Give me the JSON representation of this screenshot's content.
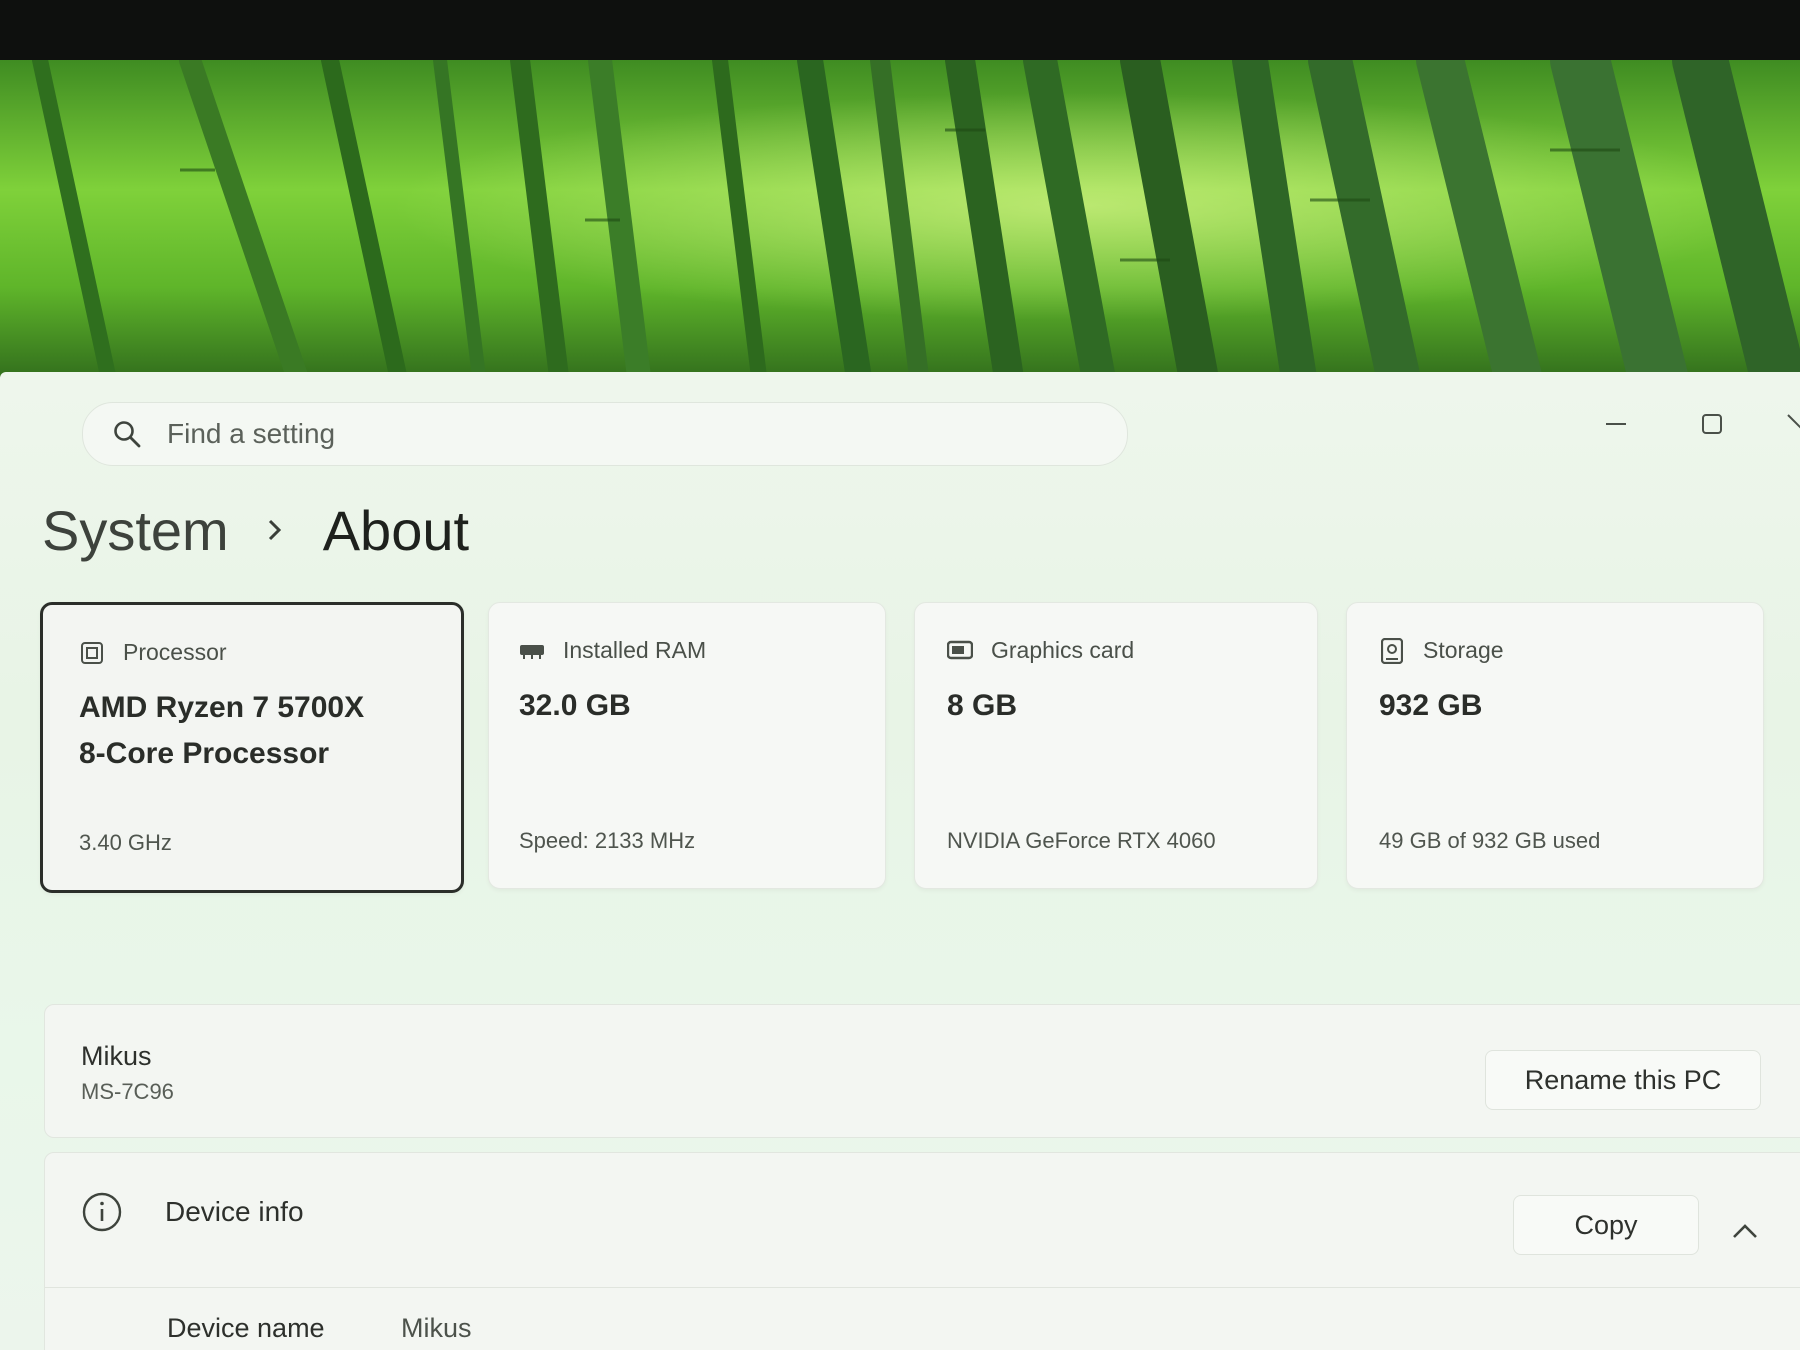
{
  "search": {
    "placeholder": "Find a setting"
  },
  "breadcrumb": {
    "parent": "System",
    "current": "About"
  },
  "specs": [
    {
      "label": "Processor",
      "icon": "processor-icon",
      "value_lines": [
        "AMD Ryzen 7 5700X",
        "8-Core Processor"
      ],
      "detail": "3.40 GHz"
    },
    {
      "label": "Installed RAM",
      "icon": "ram-icon",
      "value_lines": [
        "32.0 GB"
      ],
      "detail": "Speed: 2133 MHz"
    },
    {
      "label": "Graphics card",
      "icon": "graphics-card-icon",
      "value_lines": [
        "8 GB"
      ],
      "detail": "NVIDIA GeForce RTX 4060"
    },
    {
      "label": "Storage",
      "icon": "storage-icon",
      "value_lines": [
        "932 GB"
      ],
      "detail": "49 GB of 932 GB used"
    }
  ],
  "pc": {
    "name": "Mikus",
    "model": "MS-7C96",
    "rename_label": "Rename this PC"
  },
  "device_info": {
    "title": "Device info",
    "copy_label": "Copy",
    "rows": [
      {
        "key": "Device name",
        "value": "Mikus"
      }
    ]
  },
  "colors": {
    "wallpaper_green": "#5fb52a",
    "window_bg": "#e8f4e6",
    "selected_border": "#2b2e2a"
  }
}
